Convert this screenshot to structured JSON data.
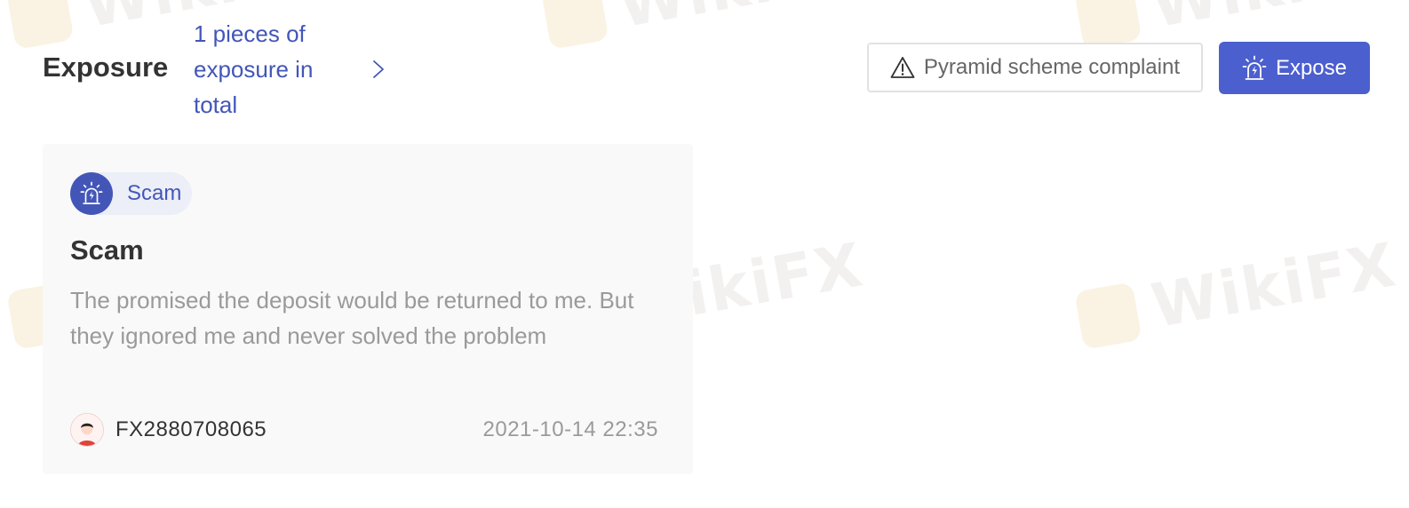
{
  "watermarks": [
    {
      "text": "WikiFX"
    },
    {
      "text": "WikiFX"
    },
    {
      "text": "WikiFX"
    },
    {
      "text": "WikiFX"
    },
    {
      "text": "WikiFX"
    },
    {
      "text": "WikiFX"
    }
  ],
  "header": {
    "title": "Exposure",
    "total_link": "1 pieces of exposure in total",
    "complaint_button": "Pyramid scheme complaint",
    "expose_button": "Expose"
  },
  "card": {
    "tag": "Scam",
    "title": "Scam",
    "description": "The promised the deposit would be returned to me. But they ignored me and never solved the problem",
    "user": "FX2880708065",
    "timestamp": "2021-10-14 22:35"
  },
  "colors": {
    "accent": "#4c5fce",
    "link": "#4356b8",
    "text_primary": "#333333",
    "text_muted": "#9a9a9a",
    "card_bg": "#f9f9f9"
  },
  "icons": {
    "chevron": "chevron-right-icon",
    "complaint": "warning-triangle-icon",
    "expose": "alarm-siren-icon",
    "tag": "alarm-siren-icon",
    "avatar": "user-avatar-icon"
  }
}
